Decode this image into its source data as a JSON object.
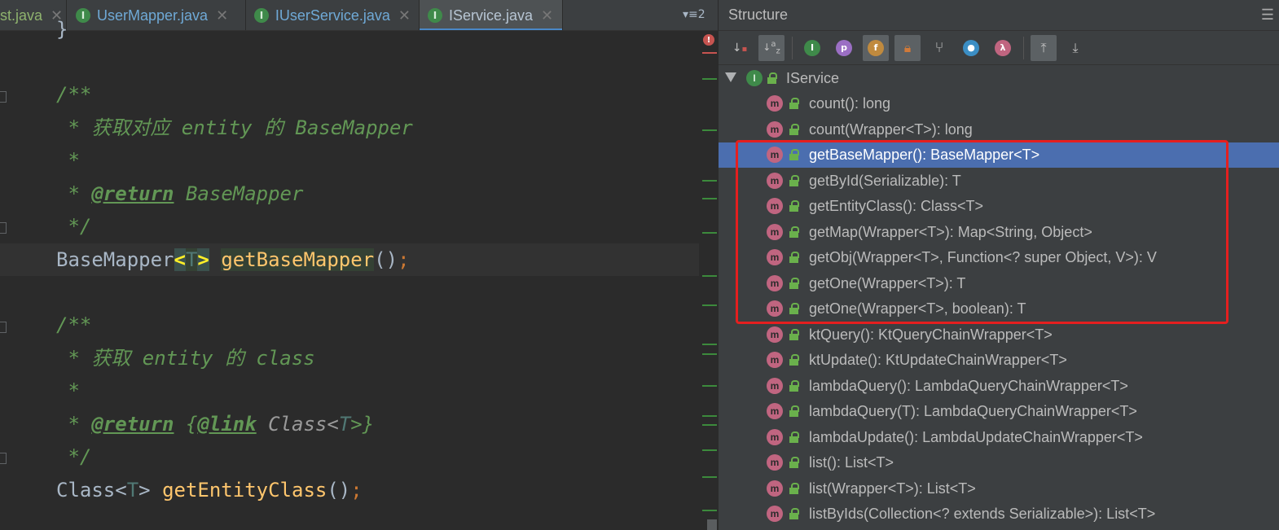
{
  "tabs": [
    {
      "label": "st.java",
      "left": -1
    },
    {
      "label": "UserMapper.java"
    },
    {
      "label": "IUserService.java"
    },
    {
      "label": "IService.java",
      "active": true
    }
  ],
  "tabs_more": "▾≡2",
  "code": {
    "l1": "}",
    "l2_open": "/**",
    "l3": " * 获取对应 entity 的 BaseMapper",
    "l4": " *",
    "l5_star": " * ",
    "l5_tag": "@return",
    "l5_rest": " BaseMapper",
    "l6": " */",
    "l7_type": "BaseMapper",
    "l7_lt": "<",
    "l7_T": "T",
    "l7_gt": ">",
    "l7_method": "getBaseMapper",
    "l7_parens": "()",
    "l7_semi": ";",
    "l8_open": "/**",
    "l9": " * 获取 entity 的 class",
    "l10": " *",
    "l11_star": " * ",
    "l11_tag": "@return",
    "l11_sp": " {",
    "l11_link": "@link",
    "l11_class": " Class<",
    "l11_T": "T",
    "l11_end": ">}",
    "l12": " */",
    "l13_type": "Class<",
    "l13_T": "T",
    "l13_gt": "> ",
    "l13_method": "getEntityClass",
    "l13_parens": "()",
    "l13_semi": ";"
  },
  "structure": {
    "title": "Structure",
    "root": "IService",
    "items": [
      "count(): long",
      "count(Wrapper<T>): long",
      "getBaseMapper(): BaseMapper<T>",
      "getById(Serializable): T",
      "getEntityClass(): Class<T>",
      "getMap(Wrapper<T>): Map<String, Object>",
      "getObj(Wrapper<T>, Function<? super Object, V>): V",
      "getOne(Wrapper<T>): T",
      "getOne(Wrapper<T>, boolean): T",
      "ktQuery(): KtQueryChainWrapper<T>",
      "ktUpdate(): KtUpdateChainWrapper<T>",
      "lambdaQuery(): LambdaQueryChainWrapper<T>",
      "lambdaQuery(T): LambdaQueryChainWrapper<T>",
      "lambdaUpdate(): LambdaUpdateChainWrapper<T>",
      "list(): List<T>",
      "list(Wrapper<T>): List<T>",
      "listByIds(Collection<? extends Serializable>): List<T>"
    ],
    "selected_index": 2
  },
  "icons": {
    "interface": "I",
    "method": "m",
    "property": "p",
    "field": "f",
    "lambda": "λ"
  },
  "colors": {
    "selection": "#4b6eaf",
    "highlight_box": "#e51f1f",
    "method_icon": "#c06580",
    "interface_icon": "#3f8a4a"
  }
}
